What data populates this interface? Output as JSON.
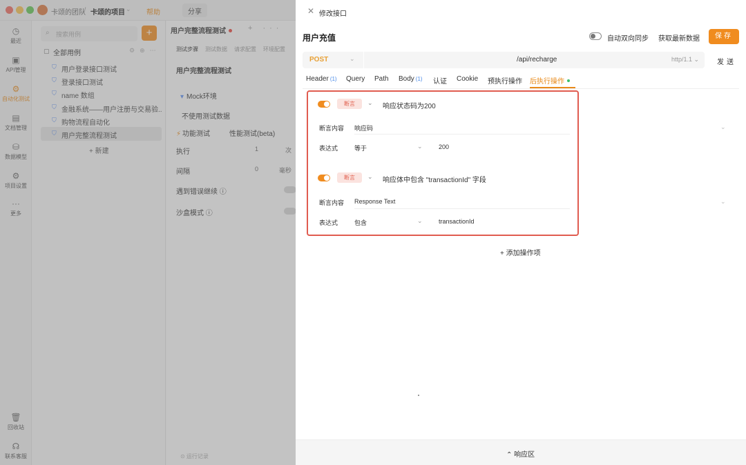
{
  "app": {
    "team": "卡颂的团队",
    "separator": "/",
    "project": "卡颂的项目",
    "help": "帮助",
    "share": "分享",
    "nav": [
      {
        "icon": "◷",
        "label": "最近"
      },
      {
        "icon": "▣",
        "label": "API管理"
      },
      {
        "icon": "⚙",
        "label": "自动化测试"
      },
      {
        "icon": "▤",
        "label": "文档管理"
      },
      {
        "icon": "⛁",
        "label": "数据模型"
      },
      {
        "icon": "⚙",
        "label": "项目设置"
      },
      {
        "icon": "···",
        "label": "更多"
      },
      {
        "icon": "🗑",
        "label": "回收站"
      },
      {
        "icon": "☊",
        "label": "联系客服"
      }
    ],
    "tree": {
      "search_placeholder": "搜索用例",
      "add": "+",
      "root": "全部用例",
      "items": [
        "用户登录接口测试",
        "登录接口测试",
        "name 数组",
        "金融系统——用户注册与交易验...",
        "购物流程自动化",
        "用户完整流程测试"
      ],
      "new_label": "+ 新建"
    },
    "main": {
      "tab": "用户完整流程测试",
      "tab_controls": "+ ···",
      "subtabs": [
        "测试步骤",
        "测试数据",
        "请求配置",
        "环境配置"
      ],
      "title": "用户完整流程测试",
      "env": "Mock环境",
      "no_data": "不使用测试数据",
      "func_test": "功能测试",
      "perf_test": "性能测试(beta)",
      "exec_label": "执行",
      "exec_value": "1",
      "exec_unit": "次",
      "interval_label": "间隔",
      "interval_value": "0",
      "interval_unit": "毫秒",
      "continue_on_error": "遇到错误继续 ⓘ",
      "sandbox": "沙盒模式 ⓘ",
      "bottom_hint": "⊙ 运行记录"
    }
  },
  "panel": {
    "close": "✕",
    "title": "修改接口",
    "name": "用户充值",
    "sync_label": "自动双向同步",
    "fetch_label": "获取最新数据",
    "save_label": "保存",
    "method": "POST",
    "url": "/api/recharge",
    "protocol": "http/1.1",
    "send_label": "发送",
    "tabs": [
      {
        "label": "Header",
        "count": "(1)"
      },
      {
        "label": "Query",
        "count": ""
      },
      {
        "label": "Path",
        "count": ""
      },
      {
        "label": "Body",
        "count": "(1)"
      },
      {
        "label": "认证",
        "count": ""
      },
      {
        "label": "Cookie",
        "count": ""
      },
      {
        "label": "预执行操作",
        "count": ""
      },
      {
        "label": "后执行操作",
        "count": ""
      }
    ],
    "assertions": [
      {
        "tag": "断言",
        "name": "响应状态码为200",
        "target_label": "断言内容",
        "target_value": "响应码",
        "expr_label": "表达式",
        "operator": "等于",
        "value": "200"
      },
      {
        "tag": "断言",
        "name": "响应体中包含 \"transactionId\" 字段",
        "target_label": "断言内容",
        "target_value": "Response Text",
        "expr_label": "表达式",
        "operator": "包含",
        "value": "transactionId"
      }
    ],
    "add_operation": "+ 添加操作项",
    "response_area": "⌃ 响应区"
  },
  "colors": {
    "accent": "#f08c1f",
    "highlight_border": "#e05b4f",
    "tag_bg": "#fbe3df",
    "count_blue": "#4a8ae8",
    "active_dot": "#3cbf6a"
  }
}
